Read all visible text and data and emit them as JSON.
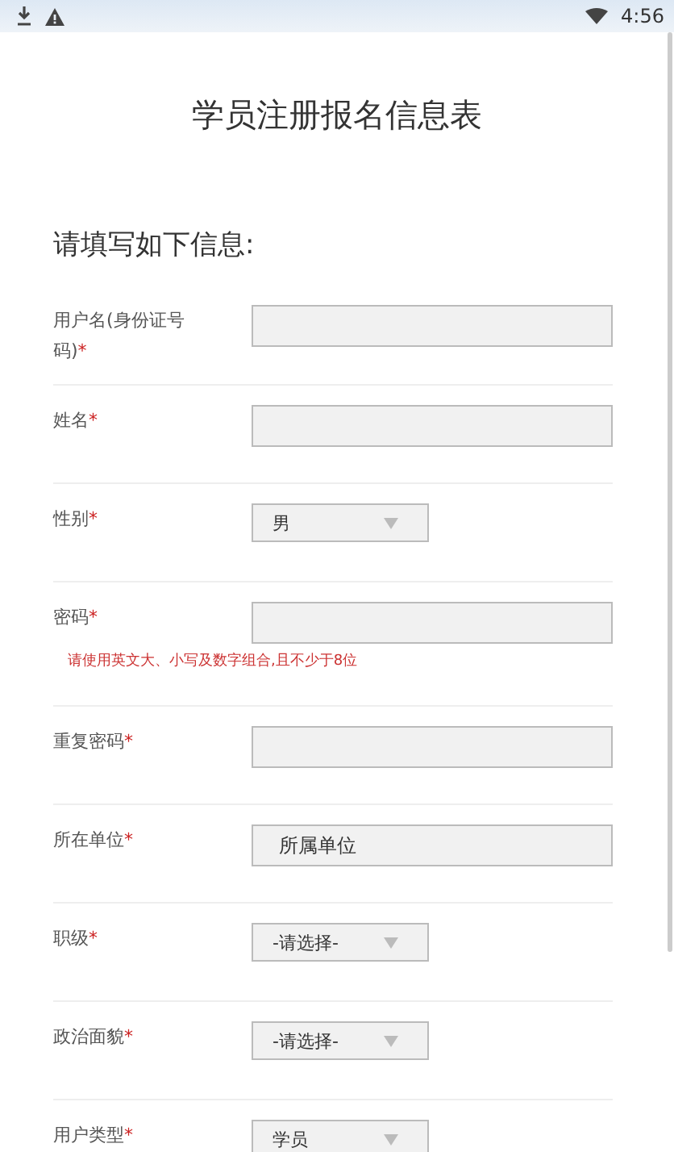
{
  "status_bar": {
    "time": "4:56"
  },
  "title": "学员注册报名信息表",
  "subtitle": "请填写如下信息:",
  "fields": [
    {
      "label": "用户名(身份证号码)",
      "mark": "*",
      "kind": "text"
    },
    {
      "label": "姓名",
      "mark": "*",
      "kind": "text"
    },
    {
      "label": "性别",
      "mark": "*",
      "kind": "select",
      "value": "男"
    },
    {
      "label": "密码",
      "mark": "*",
      "kind": "text",
      "hint": "请使用英文大、小写及数字组合,且不少于8位"
    },
    {
      "label": "重复密码",
      "mark": "*",
      "kind": "text"
    },
    {
      "label": "所在单位",
      "mark": "*",
      "kind": "text",
      "value": "所属单位"
    },
    {
      "label": "职级",
      "mark": "*",
      "kind": "select",
      "value": "-请选择-"
    },
    {
      "label": "政治面貌",
      "mark": "*",
      "kind": "select",
      "value": "-请选择-"
    },
    {
      "label": "用户类型",
      "mark": "*",
      "kind": "select",
      "value": "学员"
    }
  ]
}
